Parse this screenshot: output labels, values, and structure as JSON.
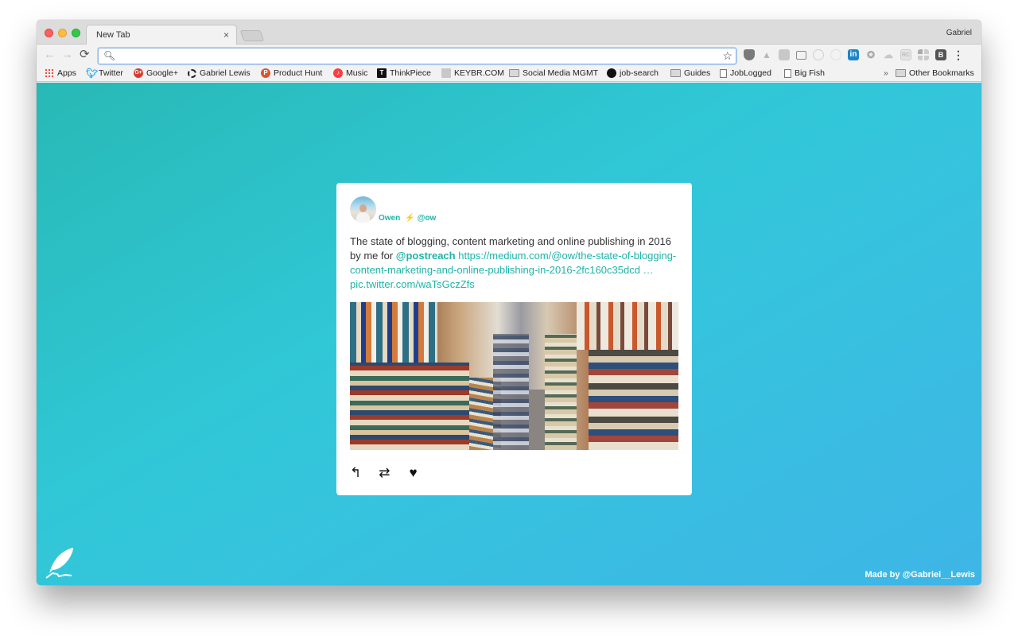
{
  "window": {
    "tab_title": "New Tab",
    "profile_name": "Gabriel"
  },
  "toolbar": {
    "back_icon": "←",
    "forward_icon": "→",
    "reload_icon": "⟳",
    "omnibox_value": "",
    "omnibox_placeholder": "",
    "extensions": [
      {
        "name": "ublock-icon"
      },
      {
        "name": "google-drive-icon"
      },
      {
        "name": "google-plus-extension-icon"
      },
      {
        "name": "cast-icon"
      },
      {
        "name": "circle-extension-icon"
      },
      {
        "name": "ring-extension-icon"
      },
      {
        "name": "linkedin-icon",
        "label": "in"
      },
      {
        "name": "owl-icon"
      },
      {
        "name": "cloud-extension-icon"
      },
      {
        "name": "rc-extension-icon",
        "label": "RC"
      },
      {
        "name": "grid-extension-icon"
      },
      {
        "name": "b-extension-icon",
        "label": "B"
      }
    ]
  },
  "bookmarks": {
    "items": [
      {
        "label": "Apps",
        "icon": "apps-icon"
      },
      {
        "label": "Twitter",
        "icon": "twitter-icon"
      },
      {
        "label": "Google+",
        "icon": "google-plus-icon"
      },
      {
        "label": "Gabriel Lewis",
        "icon": "site-icon"
      },
      {
        "label": "Product Hunt",
        "icon": "product-hunt-icon"
      },
      {
        "label": "Music",
        "icon": "music-icon"
      },
      {
        "label": "ThinkPiece",
        "icon": "thinkpiece-icon"
      },
      {
        "label": "KEYBR.COM",
        "icon": "keybr-icon"
      },
      {
        "label": "Social Media MGMT",
        "icon": "folder-icon"
      },
      {
        "label": "job-search",
        "icon": "github-icon"
      },
      {
        "label": "Guides",
        "icon": "folder-icon"
      },
      {
        "label": "JobLogged",
        "icon": "page-icon"
      },
      {
        "label": "Big Fish",
        "icon": "page-icon"
      }
    ],
    "overflow": "»",
    "other_label": "Other Bookmarks"
  },
  "tweet": {
    "author_name": "Owen",
    "bolt": "⚡",
    "handle": "@ow",
    "text_before": "The state of blogging, content marketing and online publishing in 2016 by me for ",
    "mention": "@postreach",
    "link": " https://medium.com/@ow/the-state-of-blogging-content-marketing-and-online-publishing-in-2016-2fc160c35dcd …pic.twitter.com/waTsGczZfs",
    "image_alt": "Bookstore aisle lined with stacks of books",
    "actions": {
      "reply": "↰",
      "retweet": "⇄",
      "like": "♥"
    }
  },
  "footer": {
    "made_by": "Made by @Gabriel__Lewis"
  },
  "colors": {
    "accent": "#20b3a8",
    "gradient_start": "#28b9b5",
    "gradient_end": "#3eb5e6"
  }
}
